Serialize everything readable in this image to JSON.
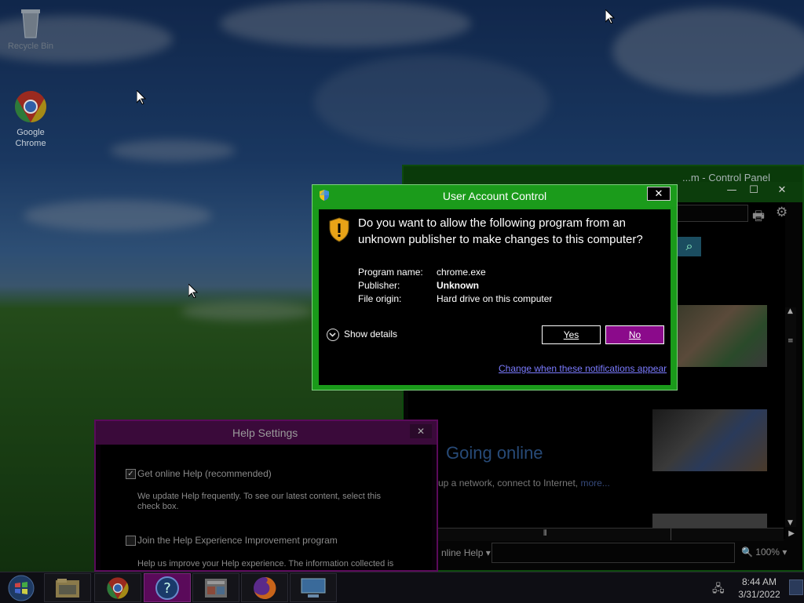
{
  "desktop": {
    "icons": [
      {
        "label": "Recycle Bin"
      },
      {
        "label": "Google\nChrome"
      }
    ]
  },
  "control_panel": {
    "title": "...m - Control Panel",
    "heading": "Going online",
    "setup_text": "up a network, connect to Internet,",
    "more_link": "more...",
    "status_help": "nline Help",
    "zoom": "100%"
  },
  "help_settings": {
    "title": "Help Settings",
    "close_label": "✕",
    "online_help_label": "Get online Help (recommended)",
    "online_help_checked": true,
    "online_help_desc": "We update Help frequently. To see our latest content, select this check box.",
    "experience_label": "Join the Help Experience Improvement program",
    "experience_checked": false,
    "experience_desc": "Help us improve your Help experience. The information collected is"
  },
  "uac": {
    "title": "User Account Control",
    "close_label": "✕",
    "question": "Do you want to allow the following program from an unknown publisher to make changes to this computer?",
    "fields": [
      {
        "label": "Program name:",
        "value": "chrome.exe"
      },
      {
        "label": "Publisher:",
        "value": "Unknown"
      },
      {
        "label": "File origin:",
        "value": "Hard drive on this computer"
      }
    ],
    "show_details": "Show details",
    "yes_label": "Yes",
    "no_label": "No",
    "change_link": "Change when these notifications appear"
  },
  "taskbar": {
    "time": "8:44 AM",
    "date": "3/31/2022"
  },
  "colors": {
    "uac_frame": "#1a9a1a",
    "no_button": "#8b0a8b",
    "link": "#7b7bff"
  }
}
